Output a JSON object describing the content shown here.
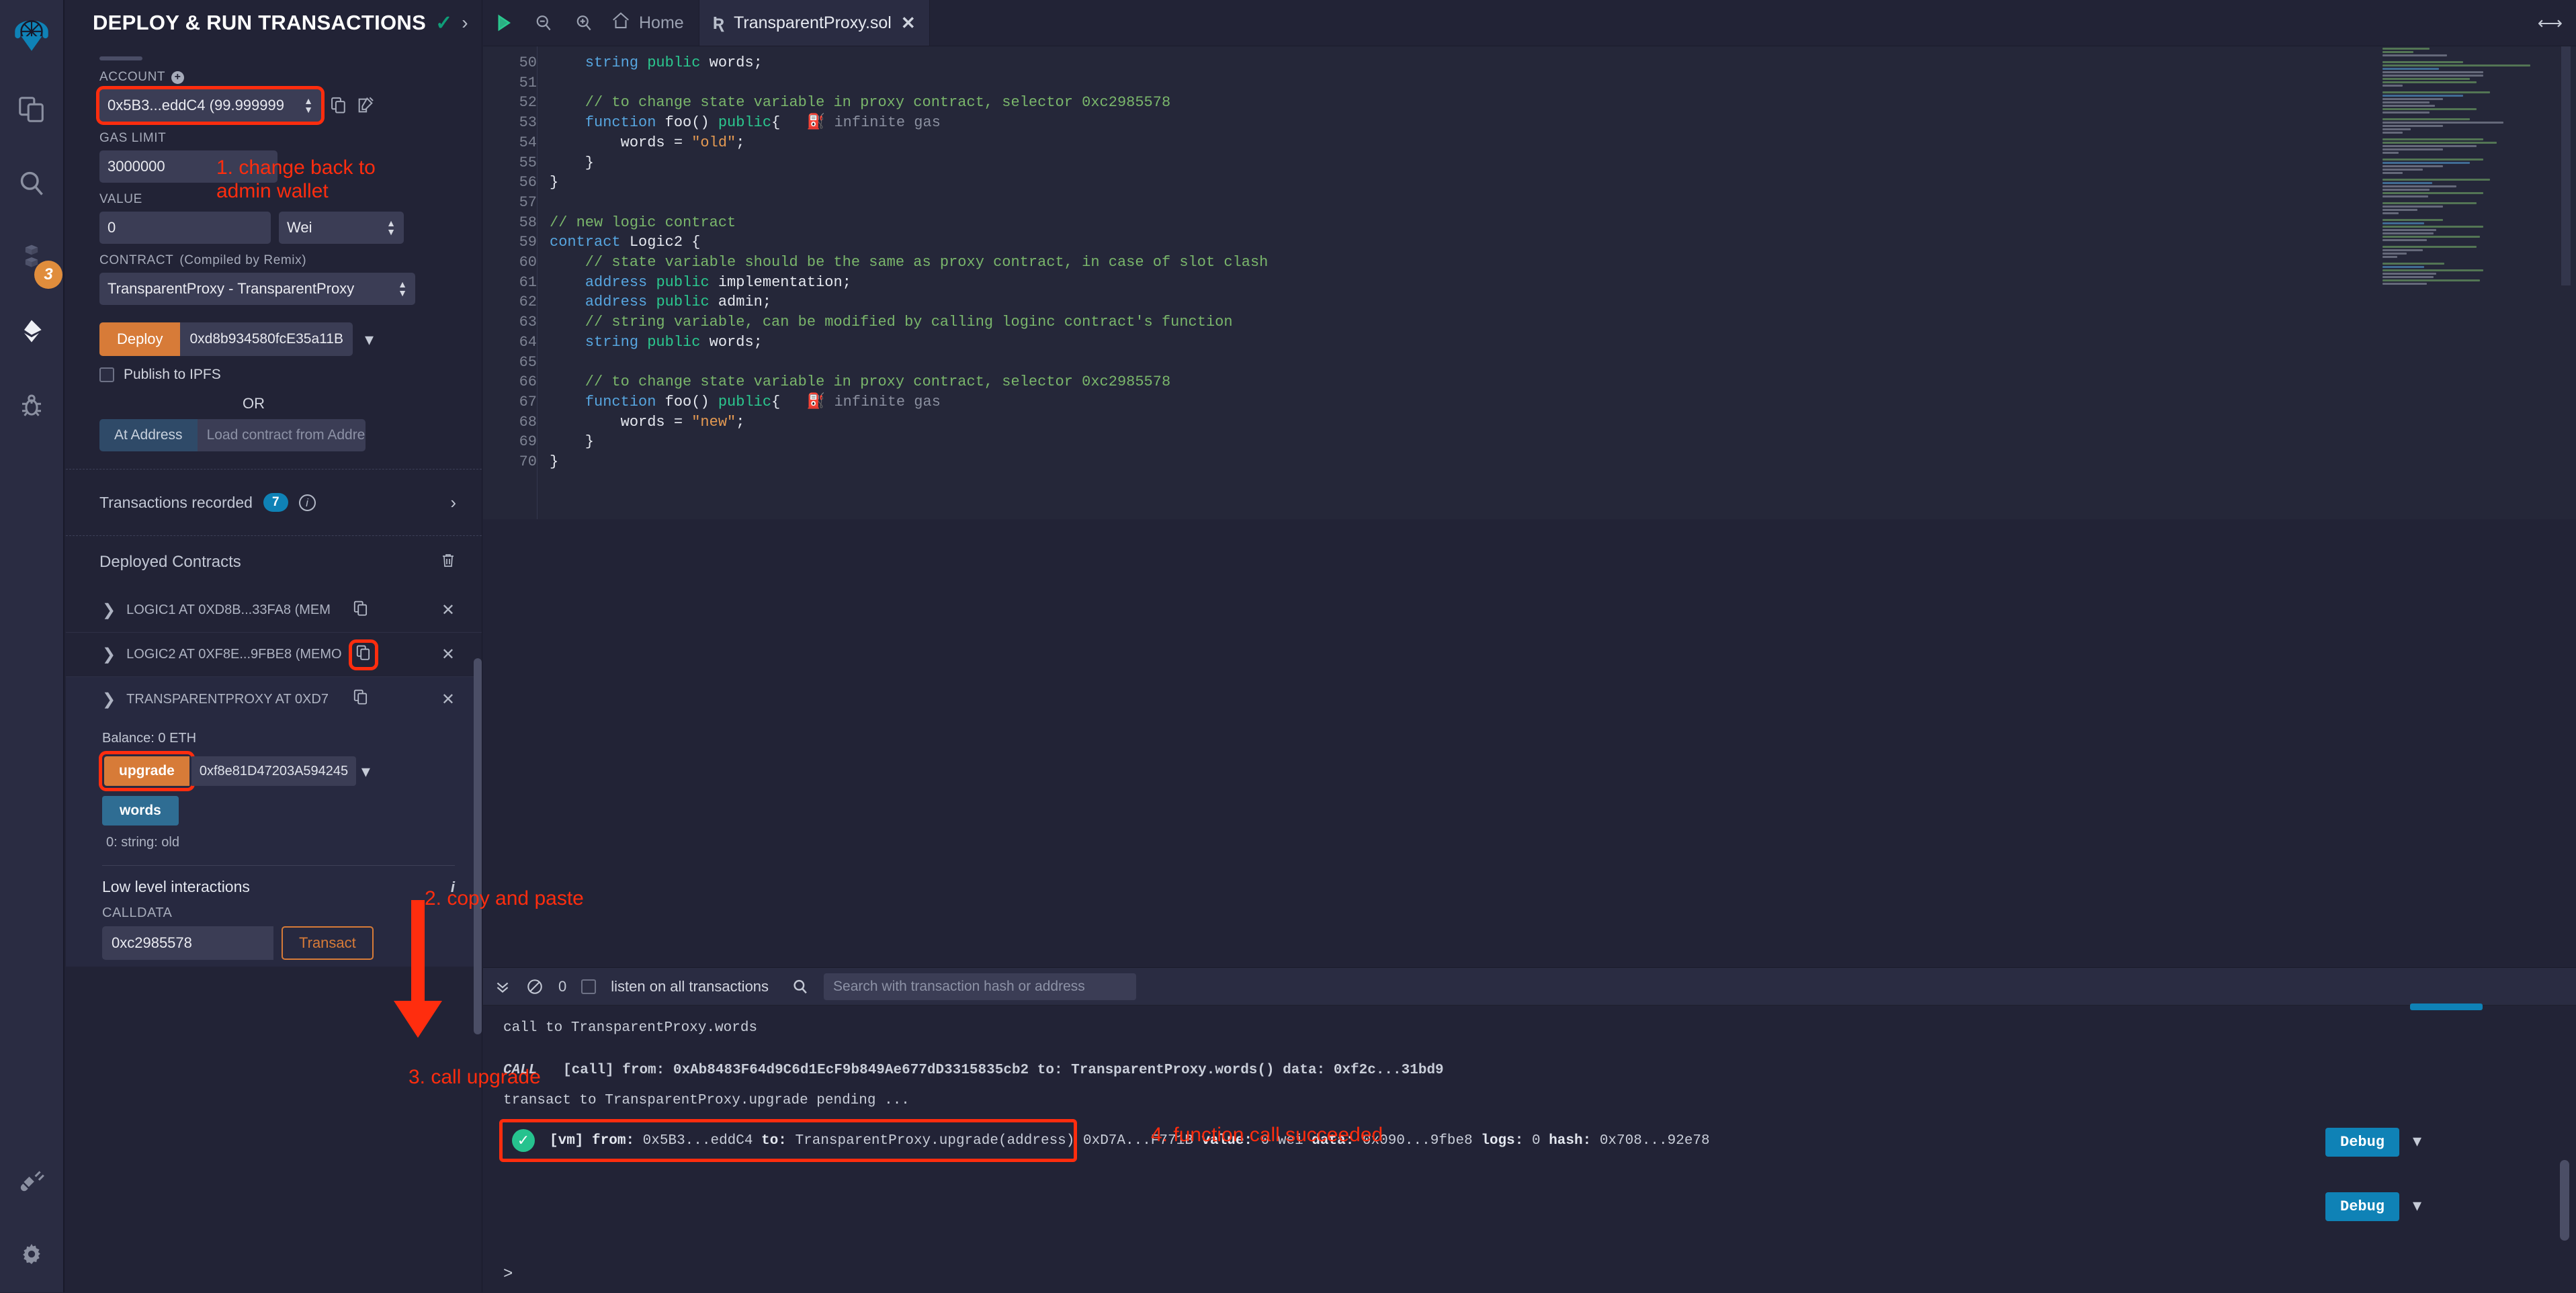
{
  "icon_bar": {
    "items": [
      {
        "name": "remix-logo-icon",
        "label": "Remix"
      },
      {
        "name": "file-explorer-icon",
        "label": "File explorer"
      },
      {
        "name": "search-icon",
        "label": "Search in files"
      },
      {
        "name": "solidity-compiler-icon",
        "label": "Solidity compiler",
        "badge": "3"
      },
      {
        "name": "deploy-run-icon",
        "label": "Deploy & run transactions"
      },
      {
        "name": "debugger-icon",
        "label": "Debugger"
      },
      {
        "name": "plugin-manager-icon",
        "label": "Plugin manager"
      },
      {
        "name": "settings-icon",
        "label": "Settings"
      }
    ]
  },
  "side_panel": {
    "title": "DEPLOY & RUN TRANSACTIONS",
    "account": {
      "label": "ACCOUNT",
      "value": "0x5B3...eddC4 (99.999999",
      "copy_icon": "copy-icon",
      "edit_icon": "edit-icon"
    },
    "gas_limit": {
      "label": "GAS LIMIT",
      "value": "3000000"
    },
    "value_field": {
      "label": "VALUE",
      "value": "0",
      "unit": "Wei"
    },
    "contract": {
      "label": "CONTRACT",
      "label_suffix": "(Compiled by Remix)",
      "value": "TransparentProxy - TransparentProxy"
    },
    "deploy": {
      "button": "Deploy",
      "address_arg": "0xd8b934580fcE35a11B",
      "publish_ipfs": "Publish to IPFS",
      "or": "OR",
      "at_address_button": "At Address",
      "at_address_placeholder": "Load contract from Address"
    },
    "transactions_recorded": {
      "label": "Transactions recorded",
      "count": "7"
    },
    "deployed_contracts": {
      "title": "Deployed Contracts",
      "items": [
        {
          "name": "LOGIC1 AT 0XD8B...33FA8 (MEM",
          "expanded": false
        },
        {
          "name": "LOGIC2 AT 0XF8E...9FBE8 (MEMO",
          "expanded": false
        },
        {
          "name": "TRANSPARENTPROXY AT 0XD7",
          "expanded": true
        }
      ]
    },
    "proxy_card": {
      "balance": "Balance: 0 ETH",
      "upgrade_button": "upgrade",
      "upgrade_arg": "0xf8e81D47203A594245",
      "words_button": "words",
      "words_result": "0: string: old"
    },
    "low_level": {
      "title": "Low level interactions",
      "calldata_label": "CALLDATA",
      "calldata_value": "0xc2985578",
      "transact_button": "Transact"
    }
  },
  "editor": {
    "toolbar": {
      "run_icon": "run-icon",
      "zoom_out_icon": "zoom-out-icon",
      "zoom_in_icon": "zoom-in-icon",
      "home_label": "Home"
    },
    "tabs": [
      {
        "label": "TransparentProxy.sol",
        "active": true,
        "close": "✕"
      }
    ],
    "first_line_number": 50,
    "lines": [
      {
        "n": 50,
        "tokens": [
          {
            "t": "    ",
            "c": "d"
          },
          {
            "t": "string",
            "c": "k"
          },
          {
            "t": " ",
            "c": "d"
          },
          {
            "t": "public",
            "c": "p"
          },
          {
            "t": " words;",
            "c": "d"
          }
        ]
      },
      {
        "n": 51,
        "tokens": []
      },
      {
        "n": 52,
        "tokens": [
          {
            "t": "    // to change state variable in proxy contract, selector 0xc2985578",
            "c": "c"
          }
        ]
      },
      {
        "n": 53,
        "tokens": [
          {
            "t": "    ",
            "c": "d"
          },
          {
            "t": "function",
            "c": "k"
          },
          {
            "t": " foo() ",
            "c": "d"
          },
          {
            "t": "public",
            "c": "p"
          },
          {
            "t": "{",
            "c": "d"
          },
          {
            "t": "   ⛽ infinite gas",
            "c": "gasann"
          }
        ]
      },
      {
        "n": 54,
        "tokens": [
          {
            "t": "        words = ",
            "c": "d"
          },
          {
            "t": "\"old\"",
            "c": "s"
          },
          {
            "t": ";",
            "c": "d"
          }
        ]
      },
      {
        "n": 55,
        "tokens": [
          {
            "t": "    }",
            "c": "d"
          }
        ]
      },
      {
        "n": 56,
        "tokens": [
          {
            "t": "}",
            "c": "d"
          }
        ]
      },
      {
        "n": 57,
        "tokens": []
      },
      {
        "n": 58,
        "tokens": [
          {
            "t": "// new logic contract",
            "c": "c"
          }
        ]
      },
      {
        "n": 59,
        "tokens": [
          {
            "t": "contract",
            "c": "k"
          },
          {
            "t": " Logic2 {",
            "c": "d"
          }
        ]
      },
      {
        "n": 60,
        "tokens": [
          {
            "t": "    // state variable should be the same as proxy contract, in case of slot clash",
            "c": "c"
          }
        ]
      },
      {
        "n": 61,
        "tokens": [
          {
            "t": "    ",
            "c": "d"
          },
          {
            "t": "address",
            "c": "k"
          },
          {
            "t": " ",
            "c": "d"
          },
          {
            "t": "public",
            "c": "p"
          },
          {
            "t": " implementation;",
            "c": "d"
          }
        ]
      },
      {
        "n": 62,
        "tokens": [
          {
            "t": "    ",
            "c": "d"
          },
          {
            "t": "address",
            "c": "k"
          },
          {
            "t": " ",
            "c": "d"
          },
          {
            "t": "public",
            "c": "p"
          },
          {
            "t": " admin;",
            "c": "d"
          }
        ]
      },
      {
        "n": 63,
        "tokens": [
          {
            "t": "    // string variable, can be modified by calling loginc contract's function",
            "c": "c"
          }
        ]
      },
      {
        "n": 64,
        "tokens": [
          {
            "t": "    ",
            "c": "d"
          },
          {
            "t": "string",
            "c": "k"
          },
          {
            "t": " ",
            "c": "d"
          },
          {
            "t": "public",
            "c": "p"
          },
          {
            "t": " words;",
            "c": "d"
          }
        ]
      },
      {
        "n": 65,
        "tokens": []
      },
      {
        "n": 66,
        "tokens": [
          {
            "t": "    // to change state variable in proxy contract, selector 0xc2985578",
            "c": "c"
          }
        ]
      },
      {
        "n": 67,
        "tokens": [
          {
            "t": "    ",
            "c": "d"
          },
          {
            "t": "function",
            "c": "k"
          },
          {
            "t": " foo() ",
            "c": "d"
          },
          {
            "t": "public",
            "c": "p"
          },
          {
            "t": "{",
            "c": "d"
          },
          {
            "t": "   ⛽ infinite gas",
            "c": "gasann"
          }
        ]
      },
      {
        "n": 68,
        "tokens": [
          {
            "t": "        words = ",
            "c": "d"
          },
          {
            "t": "\"new\"",
            "c": "s"
          },
          {
            "t": ";",
            "c": "d"
          }
        ]
      },
      {
        "n": 69,
        "tokens": [
          {
            "t": "    }",
            "c": "d"
          }
        ]
      },
      {
        "n": 70,
        "tokens": [
          {
            "t": "}",
            "c": "d"
          }
        ]
      }
    ]
  },
  "terminal": {
    "toolbar": {
      "collapse_icon": "chevrons-down-icon",
      "clear_icon": "no-entry-icon",
      "pending_count": "0",
      "listen_label": "listen on all transactions",
      "search_icon": "search-icon",
      "search_placeholder": "Search with transaction hash or address"
    },
    "log_lines": [
      "call to TransparentProxy.words",
      "transact to TransparentProxy.upgrade pending ..."
    ],
    "call_entry": {
      "tag": "CALL",
      "text": "[call] from: 0xAb8483F64d9C6d1EcF9b849Ae677dD3315835cb2 to: TransparentProxy.words() data: 0xf2c...31bd9"
    },
    "tx_entry": {
      "status_icon": "check-circle-icon",
      "prefix": "[vm]",
      "from_label": "from:",
      "from": "0x5B3...eddC4",
      "to_label": "to:",
      "to": "TransparentProxy.upgrade(address) 0xD7A...F771B",
      "value_label": "value:",
      "value": "0 wei",
      "data_label": "data:",
      "data": "0x090...9fbe8",
      "logs_label": "logs:",
      "logs": "0",
      "hash_label": "hash:",
      "hash": "0x708...92e78"
    },
    "debug_buttons": [
      "Debug",
      "Debug"
    ],
    "prompt": ">"
  },
  "annotations": [
    {
      "id": "step-1",
      "text": "1. change back to\nadmin wallet"
    },
    {
      "id": "step-2",
      "text": "2. copy and paste"
    },
    {
      "id": "step-3",
      "text": "3. call upgrade"
    },
    {
      "id": "step-4",
      "text": "4. function call succeeded"
    }
  ],
  "colors": {
    "accent_orange": "#d77b38",
    "accent_blue": "#0f82b6",
    "annotation_red": "#ff2d0e",
    "success_green": "#26c28e",
    "panel_bg": "#222336",
    "surface_bg": "#2a2c42",
    "input_bg": "#3b3d55"
  }
}
